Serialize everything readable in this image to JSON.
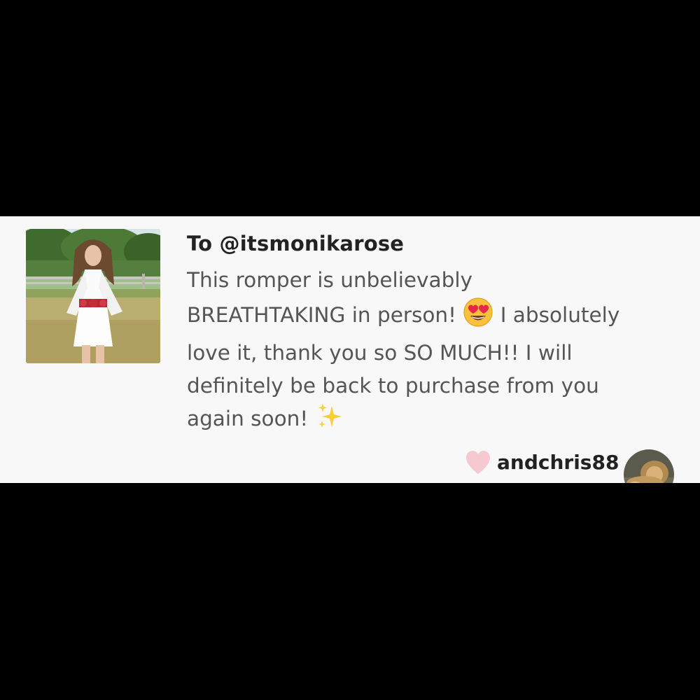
{
  "card": {
    "addressee": "To @itsmonikarose",
    "message_lines": [
      "This romper is unbelievably",
      "BREATHTAKING in person!",
      "I absolutely",
      "love it, thank you so SO MUCH!! I will",
      "definitely be back to purchase from you",
      "again soon!"
    ],
    "emojis": [
      "heart-eyes-emoji",
      "sparkles-emoji"
    ],
    "liker": {
      "username": "andchris88",
      "icon": "heart-icon",
      "heart_color": "#f6c9d0"
    }
  },
  "colors": {
    "background": "#000000",
    "card_background": "#f9f8f9",
    "title_text": "#222222",
    "body_text": "#555555"
  }
}
